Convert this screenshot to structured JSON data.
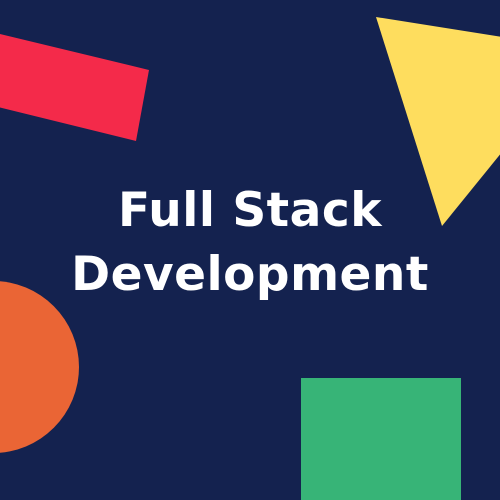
{
  "title": {
    "line1": "Full Stack",
    "line2": "Development"
  },
  "colors": {
    "background": "#14224F",
    "text": "#FFFFFF",
    "red_bar": "#F42A4A",
    "yellow_triangle": "#FEDD5E",
    "orange_circle": "#EA6535",
    "green_square": "#37B477"
  }
}
